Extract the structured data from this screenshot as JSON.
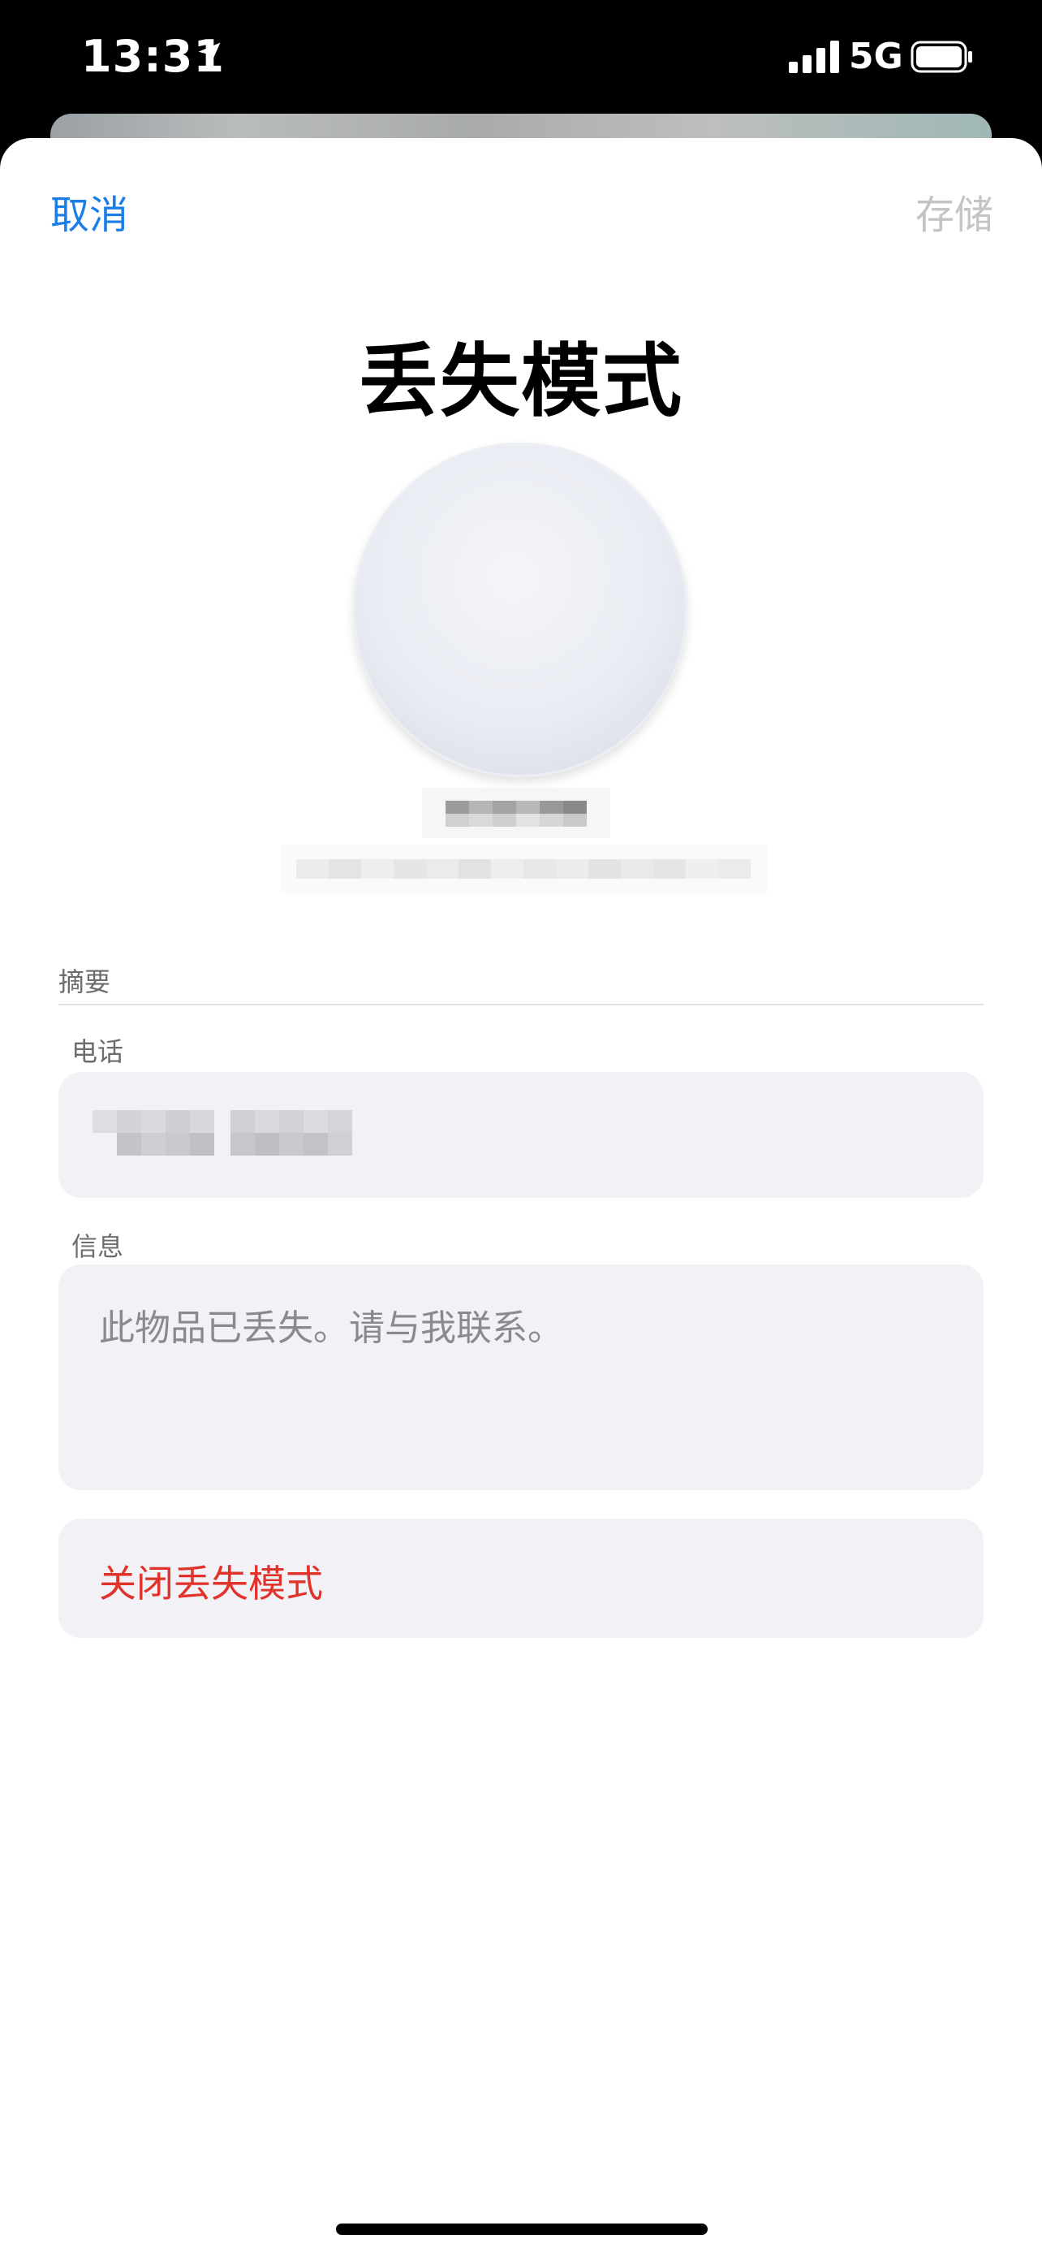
{
  "status_bar": {
    "time": "13:31",
    "network": "5G",
    "icons": [
      "location-arrow-icon",
      "signal-bars-icon",
      "battery-icon"
    ]
  },
  "nav": {
    "cancel_label": "取消",
    "save_label": "存储"
  },
  "title": "丢失模式",
  "summary_label": "摘要",
  "phone": {
    "label": "电话"
  },
  "message": {
    "label": "信息",
    "placeholder": "此物品已丢失。请与我联系。"
  },
  "turn_off_label": "关闭丢失模式",
  "colors": {
    "accent": "#1a7ee6",
    "destructive": "#e0332c",
    "disabled": "#c4c4c6",
    "field_background": "#f1f1f6"
  }
}
